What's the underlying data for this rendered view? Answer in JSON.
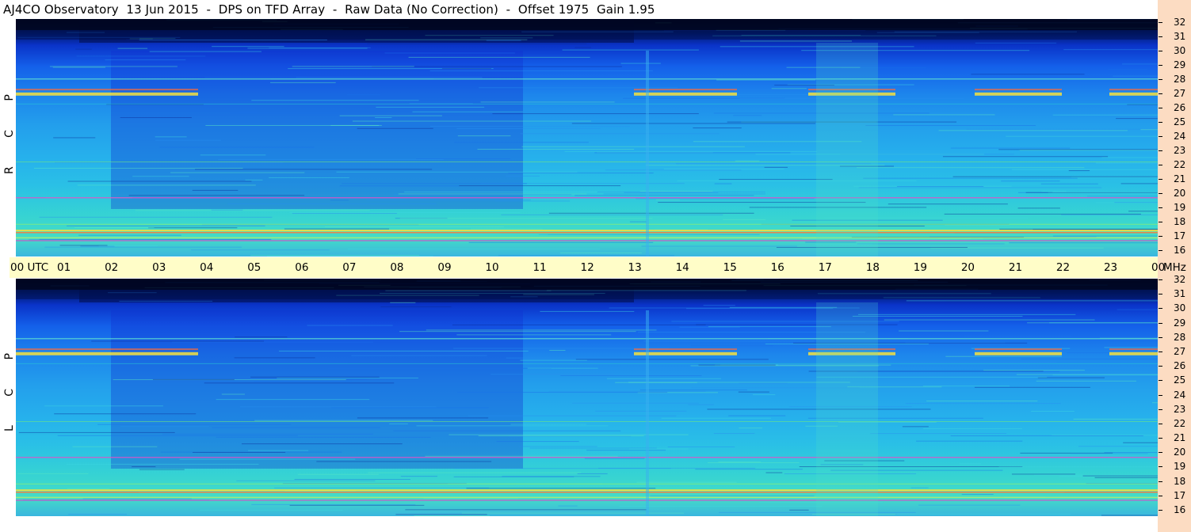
{
  "title": "AJ4CO Observatory  13 Jun 2015  -  DPS on TFD Array  -  Raw Data (No Correction)  -  Offset 1975  Gain 1.95",
  "chart_data": {
    "type": "heatmap",
    "panels": [
      {
        "label": "R C P",
        "freq_range_mhz": [
          16,
          32
        ]
      },
      {
        "label": "L C P",
        "freq_range_mhz": [
          16,
          32
        ]
      }
    ],
    "time_labels": [
      "00 UTC",
      "01",
      "02",
      "03",
      "04",
      "05",
      "06",
      "07",
      "08",
      "09",
      "10",
      "11",
      "12",
      "13",
      "14",
      "15",
      "16",
      "17",
      "18",
      "19",
      "20",
      "21",
      "22",
      "23",
      "00"
    ],
    "time_range_utc": [
      0,
      24
    ],
    "freq_ticks": [
      "32",
      "31",
      "30",
      "29",
      "28",
      "27",
      "26",
      "25",
      "24",
      "23",
      "22",
      "21",
      "20",
      "19",
      "18",
      "17",
      "16"
    ],
    "freq_unit": "MHz",
    "bands_mhz": [
      17.1,
      17.4,
      17.8,
      20.0,
      27.0,
      28.0
    ],
    "colormap": [
      "#00082a",
      "#0a33c8",
      "#1d86ec",
      "#2ac0e6",
      "#44dcc6",
      "#f5e840",
      "#ff6040",
      "#e020d0"
    ]
  }
}
